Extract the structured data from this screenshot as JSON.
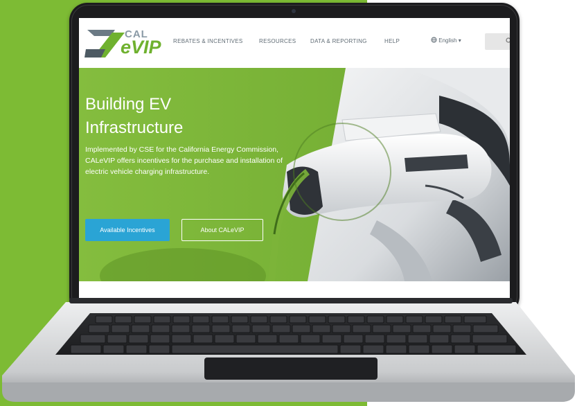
{
  "site": {
    "logo": {
      "cal": "CAL",
      "evip": "eVIP"
    },
    "nav": {
      "items": [
        {
          "label": "REBATES & INCENTIVES"
        },
        {
          "label": "RESOURCES"
        },
        {
          "label": "DATA & REPORTING"
        },
        {
          "label": "HELP"
        }
      ],
      "language": "English ▾"
    },
    "hero": {
      "title_line1": "Building EV",
      "title_line2": "Infrastructure",
      "description": "Implemented by CSE for the California Energy Commission, CALeVIP offers incentives for the purchase and installation of electric vehicle charging infrastructure.",
      "primary_button": "Available Incentives",
      "secondary_button": "About CALeVIP"
    }
  },
  "colors": {
    "background_green": "#7dbb34",
    "hero_green": "#7cb43a",
    "button_blue": "#2aa4d5",
    "laptop_frame": "#1c1c1e",
    "logo_green": "#6fb12f",
    "logo_gray": "#8a9aa6"
  },
  "icons": {
    "search": "search-icon",
    "globe": "globe-icon"
  }
}
